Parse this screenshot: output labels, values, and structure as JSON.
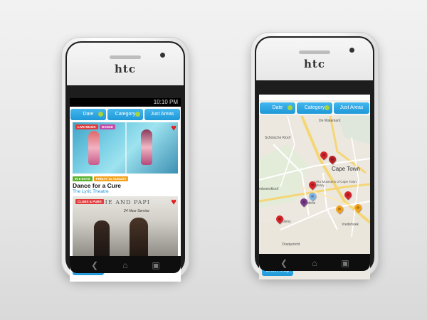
{
  "left_phone": {
    "brand": "htc",
    "status_time": "10:10 PM",
    "filters": [
      "Date",
      "Category",
      "Just Areas"
    ],
    "card1": {
      "tags": [
        "LIVE MUSIC",
        "DANCE"
      ],
      "badges": [
        "IN 6 DAYS",
        "FRIDAY 11 AUGUST"
      ],
      "title": "Dance for a Cure",
      "venue": "The Lyric Theatre"
    },
    "card2": {
      "tags": [
        "CLUBS & PUBS"
      ],
      "poster_text_1": "EDDIE AND PAPI",
      "poster_text_2": "24 Hour Service"
    },
    "show_map": "Show Map"
  },
  "right_phone": {
    "brand": "htc",
    "filters": [
      "Date",
      "Category",
      "Just Areas"
    ],
    "map_labels": {
      "city": "Cape Town",
      "de_waterkant": "De Waterkant",
      "schotsche_kloof": "Schotsche Kloof",
      "museum": "Iziko Museums of Cape Town Library",
      "vredehoek": "Vredehoek",
      "oranjezicht": "Oranjezicht",
      "tamboerskloof": "mboerskloof",
      "gardens": "Gardens",
      "jens": "Jens"
    },
    "show_map": "Show Map"
  },
  "colors": {
    "accent": "#1f98d8",
    "pin_red": "#d8232a",
    "pin_orange": "#f2a21c",
    "pin_purple": "#7a3a8c",
    "pin_blue": "#7fb4e6",
    "tag_green": "#5cb130",
    "tag_orange": "#f2a21c",
    "tag_red": "#e23c3c"
  }
}
